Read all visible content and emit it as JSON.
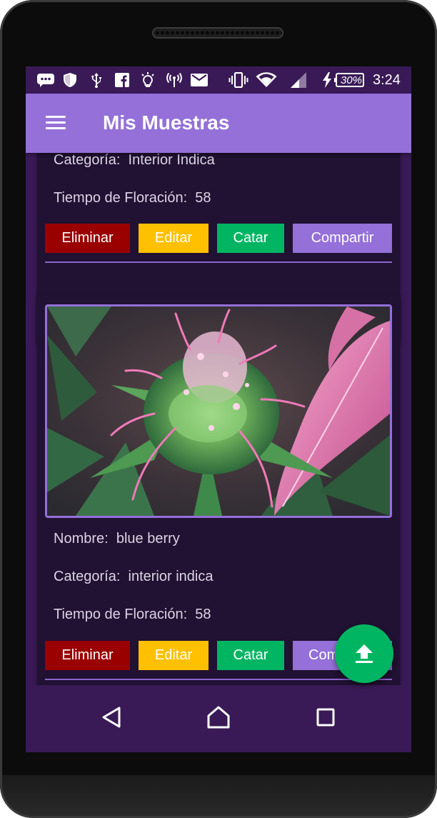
{
  "status_bar": {
    "battery_percent": "30%",
    "time": "3:24",
    "icons": [
      "chat-icon",
      "shield-icon",
      "usb-icon",
      "facebook-icon",
      "bulb-icon",
      "hotspot-icon",
      "mail-icon",
      "vibrate-icon",
      "wifi-icon",
      "signal-icon",
      "charging-icon",
      "battery-icon"
    ]
  },
  "app_bar": {
    "title": "Mis Muestras",
    "menu_icon": "hamburger-menu-icon"
  },
  "labels": {
    "nombre": "Nombre:",
    "categoria": "Categoría:",
    "tiempo": "Tiempo de Floración:"
  },
  "cards": [
    {
      "categoria": "Interior Indica",
      "tiempo_floracion": "58"
    },
    {
      "nombre": "blue berry",
      "categoria": "interior indica",
      "tiempo_floracion": "58",
      "image_icon": "cannabis-plant-photo"
    }
  ],
  "buttons": {
    "eliminar": "Eliminar",
    "editar": "Editar",
    "catar": "Catar",
    "compartir": "Compartir"
  },
  "fab": {
    "icon": "upload-icon"
  },
  "nav_bar": {
    "icons": [
      "back-icon",
      "home-icon",
      "recents-icon"
    ]
  },
  "colors": {
    "background": "#391a56",
    "card": "#211132",
    "app_bar": "#9470d8",
    "eliminar": "#9a0000",
    "editar": "#ffc000",
    "catar": "#00b562",
    "compartir": "#9470d8",
    "fab": "#00b562"
  }
}
